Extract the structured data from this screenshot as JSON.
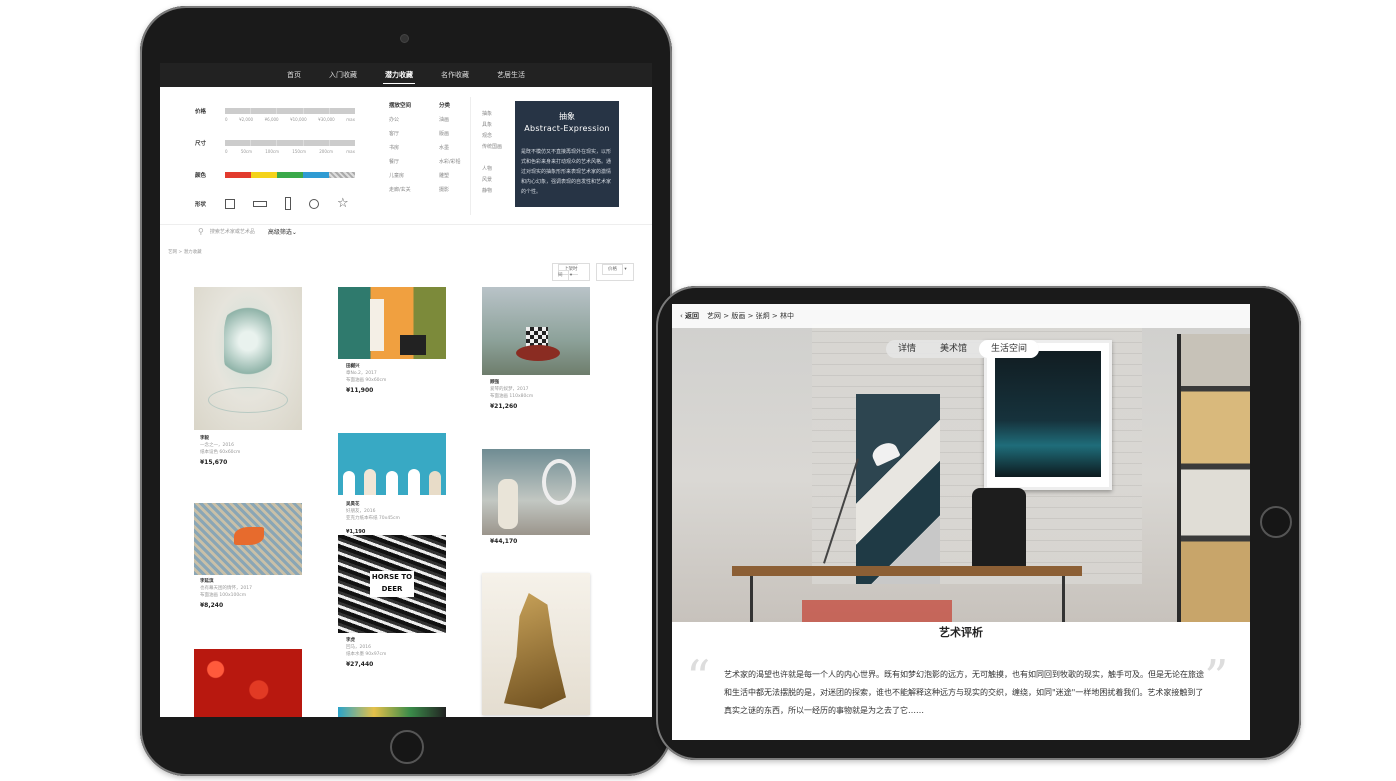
{
  "portrait": {
    "nav": [
      "首页",
      "入门收藏",
      "潜力收藏",
      "名作收藏",
      "艺居生活"
    ],
    "filters": {
      "price_label": "价格",
      "price_ticks": [
        "0",
        "¥2,000",
        "¥6,000",
        "¥10,000",
        "¥30,000",
        "max"
      ],
      "size_label": "尺寸",
      "size_ticks": [
        "0",
        "50cm",
        "100cm",
        "150cm",
        "200cm",
        "max"
      ],
      "color_label": "颜色",
      "colors": [
        "#e23b2e",
        "#f4d31a",
        "#3aa94a",
        "#2f9bd3",
        "#bfbfbf"
      ],
      "shape_label": "形状"
    },
    "space": {
      "title": "摆放空间",
      "items": [
        "办公",
        "客厅",
        "书房",
        "餐厅",
        "儿童房",
        "走廊/玄关"
      ]
    },
    "category": {
      "title": "分类",
      "items": [
        "油画",
        "版画",
        "水墨",
        "水彩/彩铅",
        "雕塑",
        "摄影"
      ]
    },
    "style": {
      "items": [
        "抽象",
        "具象",
        "观念",
        "传统国画",
        "",
        "人物",
        "风景",
        "静物"
      ]
    },
    "card": {
      "title": "抽象",
      "subtitle": "Abstract-Expression",
      "desc": "是既不模仿又不直接再现外在现实，以形式和色彩来身来打动观众的艺术风格。通过对现实的抽象形形来表现艺术家的激情和内心幻象，强调表现的自发性和艺术家的个性。"
    },
    "search_placeholder": "搜索艺术家或艺术品",
    "advanced": "高级筛选",
    "breadcrumb": "艺网 > 潜力收藏",
    "sort": [
      "上架时间",
      "价格"
    ],
    "artworks": [
      {
        "name": "李毅",
        "meta1": "一念之一，2016",
        "meta2": "纸本设色  60x60cm",
        "price": "¥15,670"
      },
      {
        "name": "田樾兴",
        "meta1": "章No.2，2017",
        "meta2": "布面油画  90x60cm",
        "price": "¥11,900"
      },
      {
        "name": "顾强",
        "meta1": "爱琴的奴梦，2017",
        "meta2": "布面油画  110x80cm",
        "price": "¥21,260"
      },
      {
        "name": "吴昊花",
        "meta1": "好朋友，2016",
        "meta2": "亚克力纸本布纸  70x45cm",
        "price": ""
      },
      {
        "name": "李延滨",
        "meta1": "也有幕天困的情怀，2017",
        "meta2": "布面油画  100x100cm",
        "price": "¥8,240"
      },
      {
        "name": "",
        "meta1": "",
        "meta2": "",
        "price": "¥44,170"
      },
      {
        "name": "李虎",
        "meta1": "回马，2016",
        "meta2": "纸本水墨  90x97cm",
        "price": "¥27,440"
      }
    ],
    "mid_price": "¥1,190",
    "sticker_text": "HORSE TO DEER"
  },
  "landscape": {
    "back": "返回",
    "breadcrumb": "艺网 > 版画 > 张炯 > 林中",
    "tabs": [
      "详情",
      "美术馆",
      "生活空间"
    ],
    "review_title": "艺术评析",
    "review_text": "艺术家的渴望也许就是每一个人的内心世界。既有如梦幻泡影的远方，无可触摸，也有如同回到牧歌的现实，触手可及。但是无论在旅途和生活中都无法摆脱的是，对迷团的探索，谁也不能解释这种远方与现实的交织，缠绕，如同\"迷途\"一样地困扰着我们。艺术家接触到了真实之谜的东西，所以一经历的事物就是为之去了它……"
  }
}
